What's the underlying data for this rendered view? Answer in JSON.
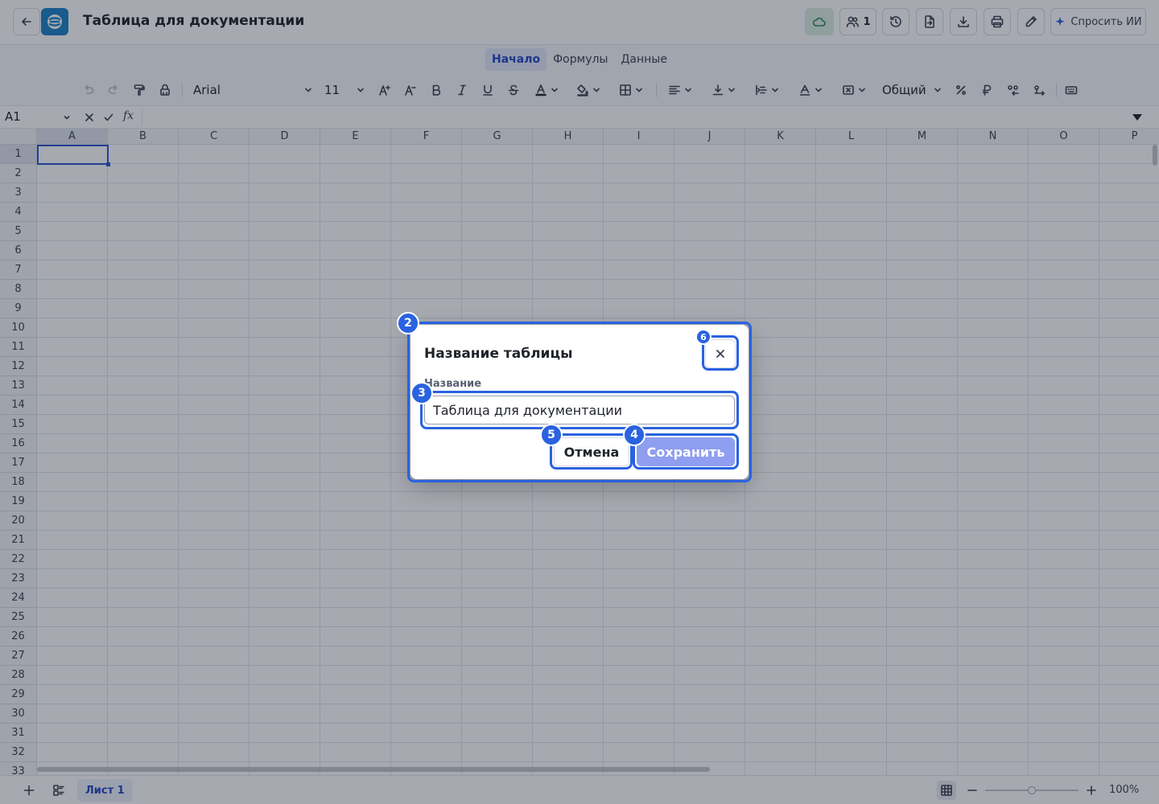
{
  "header": {
    "title": "Таблица для документации",
    "collaborators_count": "1",
    "ask_ai_label": "Спросить ИИ",
    "icons": [
      "back-icon",
      "logo-icon",
      "cloud-sync-icon",
      "users-icon",
      "history-icon",
      "import-icon",
      "download-icon",
      "print-icon",
      "edit-icon",
      "sparkle-icon"
    ]
  },
  "tabs": [
    {
      "label": "Начало",
      "active": true
    },
    {
      "label": "Формулы",
      "active": false
    },
    {
      "label": "Данные",
      "active": false
    }
  ],
  "toolbar": {
    "font_family": "Arial",
    "font_size": "11",
    "number_format": "Общий"
  },
  "formula_bar": {
    "cell_ref": "A1",
    "fx_label": "fx",
    "value": ""
  },
  "grid": {
    "columns": [
      "A",
      "B",
      "C",
      "D",
      "E",
      "F",
      "G",
      "H",
      "I",
      "J",
      "K",
      "L",
      "M",
      "N",
      "O",
      "P"
    ],
    "rows": [
      "1",
      "2",
      "3",
      "4",
      "5",
      "6",
      "7",
      "8",
      "9",
      "10",
      "11",
      "12",
      "13",
      "14",
      "15",
      "16",
      "17",
      "18",
      "19",
      "20",
      "21",
      "22",
      "23",
      "24",
      "25",
      "26",
      "27",
      "28",
      "29",
      "30",
      "31",
      "32",
      "33"
    ],
    "selected_cell": "A1"
  },
  "bottom_bar": {
    "sheet_name": "Лист 1",
    "zoom": "100%",
    "zoom_level": 0.5
  },
  "modal": {
    "title": "Название таблицы",
    "field_label": "Название",
    "field_value": "Таблица для документации",
    "cancel_label": "Отмена",
    "save_label": "Сохранить"
  },
  "annotations": {
    "dialog": "2",
    "name_input": "3",
    "save_button": "4",
    "cancel_button": "5",
    "close_button": "6"
  },
  "colors": {
    "accent": "#2a62e0",
    "active_tab": "#2346c4",
    "save_button": "#8f9ef0"
  }
}
